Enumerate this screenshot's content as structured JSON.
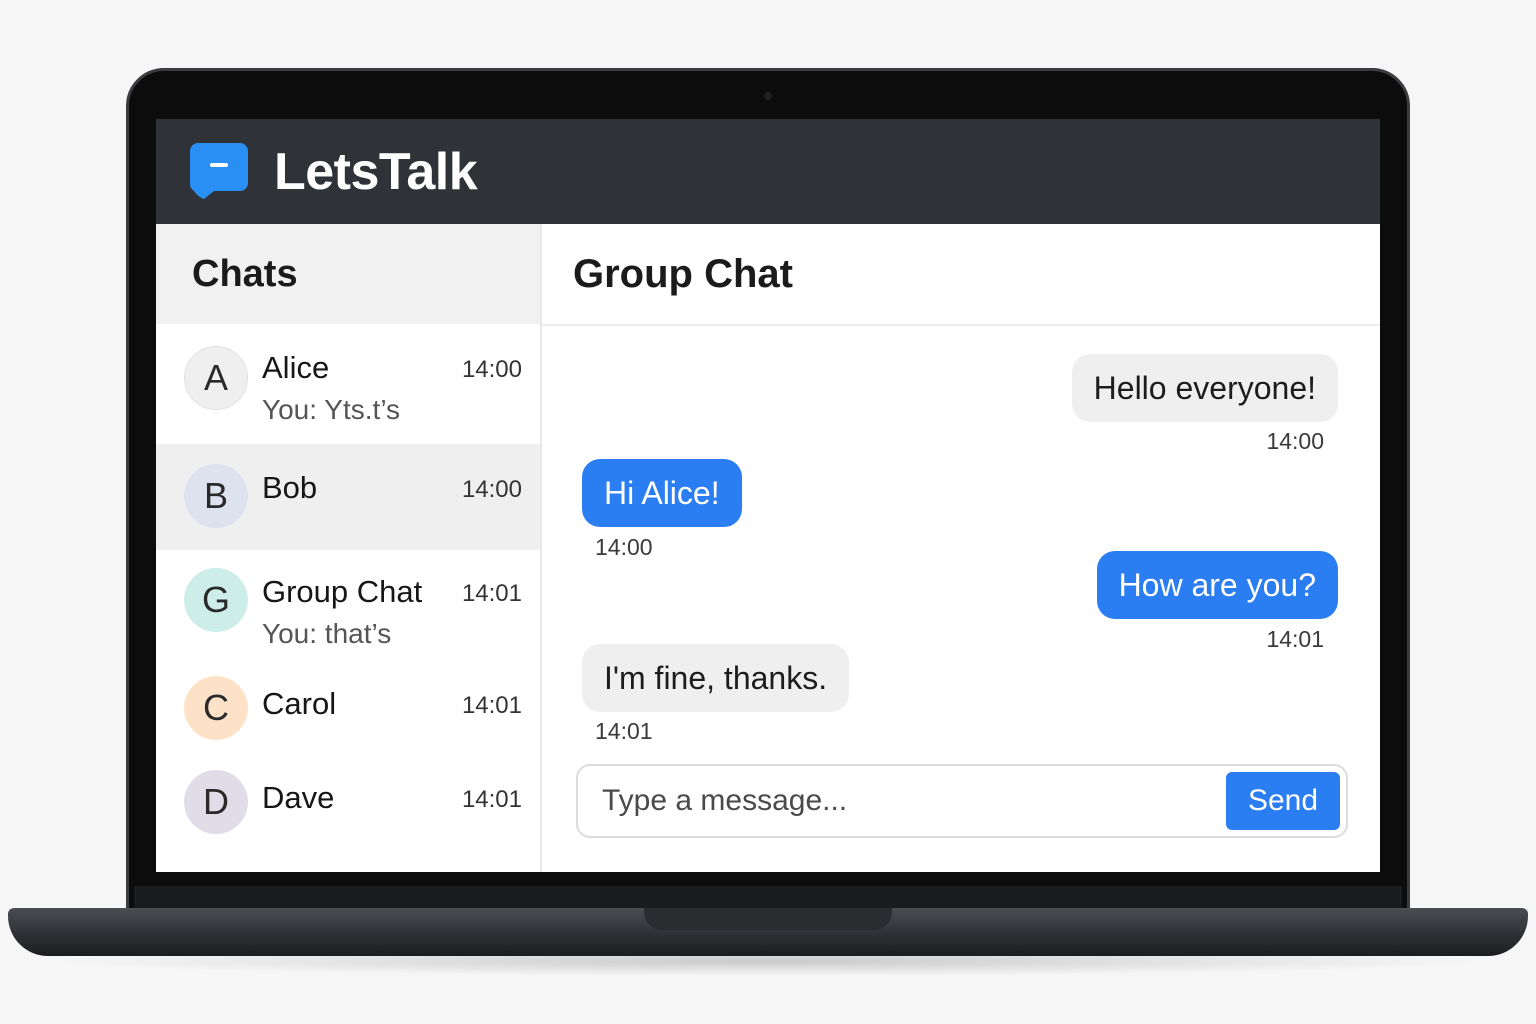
{
  "app": {
    "brand": "LetsTalk",
    "logo_icon": "chat-bubble-icon",
    "accent": "#2a7ef2"
  },
  "sidebar": {
    "title": "Chats",
    "chats": [
      {
        "initial": "A",
        "name": "Alice",
        "time": "14:00",
        "preview": "You: Yts.t’s",
        "avatar_color": "#efefef",
        "active": false
      },
      {
        "initial": "B",
        "name": "Bob",
        "time": "14:00",
        "preview": "",
        "avatar_color": "#dde3ee",
        "active": true
      },
      {
        "initial": "G",
        "name": "Group Chat",
        "time": "14:01",
        "preview": "You: that’s",
        "avatar_color": "#cdeee8",
        "active": false
      },
      {
        "initial": "C",
        "name": "Carol",
        "time": "14:01",
        "preview": "",
        "avatar_color": "#fde2c8",
        "active": false
      },
      {
        "initial": "D",
        "name": "Dave",
        "time": "14:01",
        "preview": "",
        "avatar_color": "#e0dde8",
        "active": false
      }
    ]
  },
  "conversation": {
    "title": "Group Chat",
    "messages": [
      {
        "text": "Hello everyone!",
        "time": "14:00",
        "side": "right",
        "style": "gray"
      },
      {
        "text": "Hi Alice!",
        "time": "14:00",
        "side": "left",
        "style": "blue"
      },
      {
        "text": "How are you?",
        "time": "14:01",
        "side": "right",
        "style": "blue"
      },
      {
        "text": "I'm fine, thanks.",
        "time": "14:01",
        "side": "left",
        "style": "gray"
      }
    ]
  },
  "composer": {
    "placeholder": "Type a message...",
    "send_label": "Send"
  }
}
